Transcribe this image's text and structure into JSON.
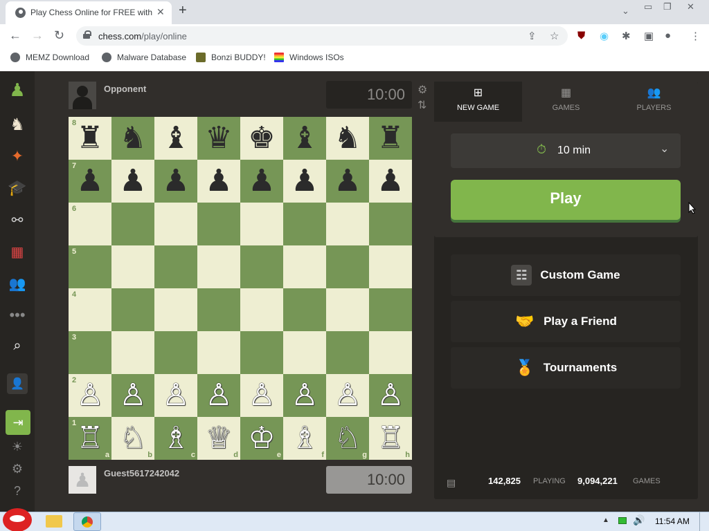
{
  "browser": {
    "tab_title": "Play Chess Online for FREE with F",
    "url_host": "chess.com",
    "url_path": "/play/online",
    "bookmarks": [
      "MEMZ Download",
      "Malware Database",
      "Bonzi BUDDY!",
      "Windows ISOs"
    ]
  },
  "opponent": {
    "name": "Opponent",
    "clock": "10:00"
  },
  "player": {
    "name": "Guest5617242042",
    "clock": "10:00"
  },
  "board": {
    "ranks": [
      "8",
      "7",
      "6",
      "5",
      "4",
      "3",
      "2",
      "1"
    ],
    "files": [
      "a",
      "b",
      "c",
      "d",
      "e",
      "f",
      "g",
      "h"
    ],
    "rows": [
      [
        "♜",
        "♞",
        "♝",
        "♛",
        "♚",
        "♝",
        "♞",
        "♜"
      ],
      [
        "♟",
        "♟",
        "♟",
        "♟",
        "♟",
        "♟",
        "♟",
        "♟"
      ],
      [
        "",
        "",
        "",
        "",
        "",
        "",
        "",
        ""
      ],
      [
        "",
        "",
        "",
        "",
        "",
        "",
        "",
        ""
      ],
      [
        "",
        "",
        "",
        "",
        "",
        "",
        "",
        ""
      ],
      [
        "",
        "",
        "",
        "",
        "",
        "",
        "",
        ""
      ],
      [
        "♙",
        "♙",
        "♙",
        "♙",
        "♙",
        "♙",
        "♙",
        "♙"
      ],
      [
        "♖",
        "♘",
        "♗",
        "♕",
        "♔",
        "♗",
        "♘",
        "♖"
      ]
    ]
  },
  "panel": {
    "tabs": [
      "NEW GAME",
      "GAMES",
      "PLAYERS"
    ],
    "time_control": "10 min",
    "play_label": "Play",
    "options": [
      "Custom Game",
      "Play a Friend",
      "Tournaments"
    ],
    "playing_count": "142,825",
    "playing_label": "PLAYING",
    "games_count": "9,094,221",
    "games_label": "GAMES"
  },
  "taskbar": {
    "time": "11:54 AM"
  },
  "colors": {
    "board_light": "#eeeed2",
    "board_dark": "#769656",
    "play_green": "#81b64c"
  }
}
